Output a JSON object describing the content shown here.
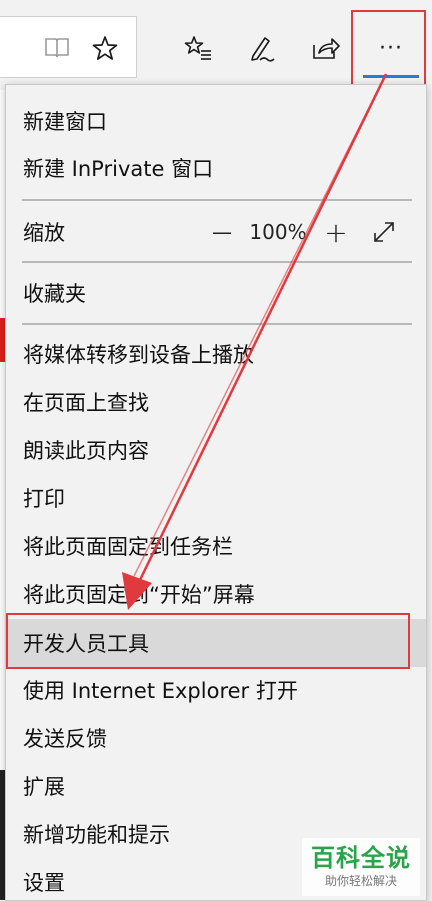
{
  "toolbar": {
    "icons": [
      "reading-view-icon",
      "favorite-star-icon",
      "hub-icon",
      "web-note-icon",
      "share-icon",
      "more-icon"
    ],
    "more_label": "···"
  },
  "menu": {
    "new_window": "新建窗口",
    "new_inprivate": "新建 InPrivate 窗口",
    "zoom_label": "缩放",
    "zoom_value": "100%",
    "zoom_out": "—",
    "zoom_in": "+",
    "favorites_bar": "收藏夹",
    "cast_media": "将媒体转移到设备上播放",
    "find_on_page": "在页面上查找",
    "read_aloud": "朗读此页内容",
    "print": "打印",
    "pin_taskbar": "将此页面固定到任务栏",
    "pin_start": "将此页固定到“开始”屏幕",
    "dev_tools": "开发人员工具",
    "open_ie": "使用 Internet Explorer 打开",
    "feedback": "发送反馈",
    "extensions": "扩展",
    "whats_new": "新增功能和提示",
    "settings": "设置"
  },
  "watermark": {
    "title": "百科全说",
    "subtitle": "助你轻松解决"
  },
  "colors": {
    "annotation_red": "#e0393e",
    "accent_blue": "#1f7fd1",
    "highlight": "#d9d9d9",
    "watermark_green": "#2aa44a"
  }
}
